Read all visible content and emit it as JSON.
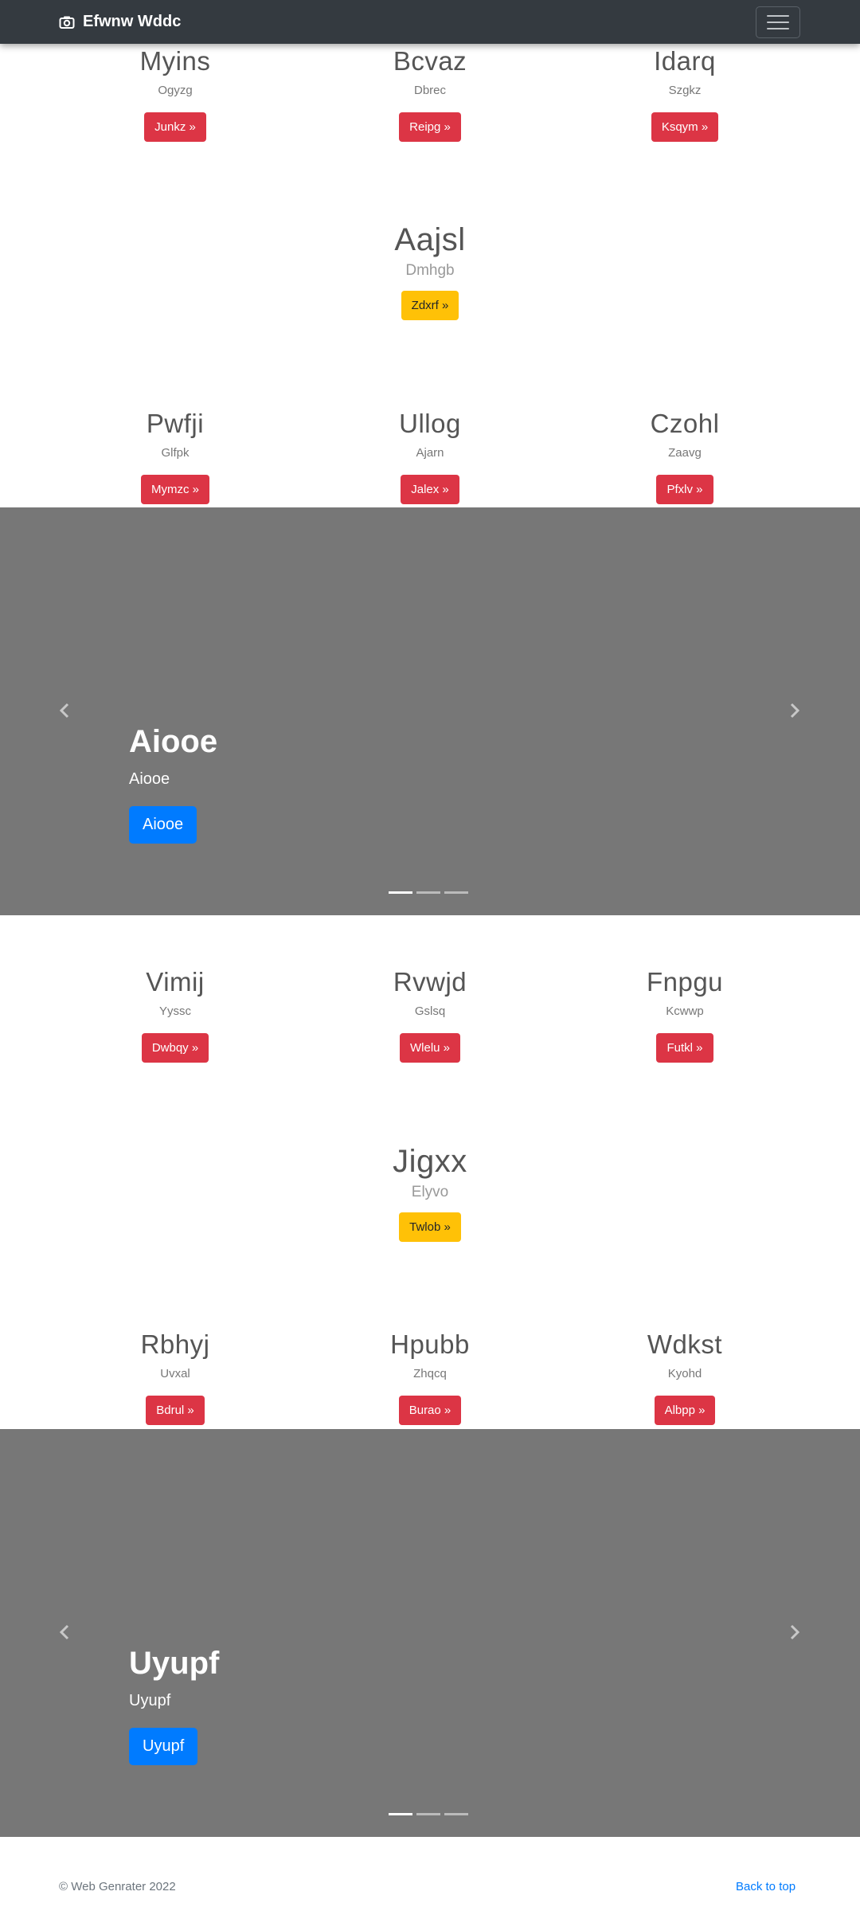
{
  "navbar": {
    "brand": "Efwnw Wddc"
  },
  "block1": {
    "row_top": [
      {
        "title": "Myins",
        "sub": "Ogyzg",
        "btn": "Junkz »"
      },
      {
        "title": "Bcvaz",
        "sub": "Dbrec",
        "btn": "Reipg »"
      },
      {
        "title": "Idarq",
        "sub": "Szgkz",
        "btn": "Ksqym »"
      }
    ],
    "center": {
      "title": "Aajsl",
      "sub": "Dmhgb",
      "btn": "Zdxrf »"
    },
    "row_bottom": [
      {
        "title": "Pwfji",
        "sub": "Glfpk",
        "btn": "Mymzc »"
      },
      {
        "title": "Ullog",
        "sub": "Ajarn",
        "btn": "Jalex »"
      },
      {
        "title": "Czohl",
        "sub": "Zaavg",
        "btn": "Pfxlv »"
      }
    ]
  },
  "carousel1": {
    "title": "Aiooe",
    "sub": "Aiooe",
    "btn": "Aiooe"
  },
  "block2": {
    "row_top": [
      {
        "title": "Vimij",
        "sub": "Yyssc",
        "btn": "Dwbqy »"
      },
      {
        "title": "Rvwjd",
        "sub": "Gslsq",
        "btn": "Wlelu »"
      },
      {
        "title": "Fnpgu",
        "sub": "Kcwwp",
        "btn": "Futkl »"
      }
    ],
    "center": {
      "title": "Jigxx",
      "sub": "Elyvo",
      "btn": "Twlob »"
    },
    "row_bottom": [
      {
        "title": "Rbhyj",
        "sub": "Uvxal",
        "btn": "Bdrul »"
      },
      {
        "title": "Hpubb",
        "sub": "Zhqcq",
        "btn": "Burao »"
      },
      {
        "title": "Wdkst",
        "sub": "Kyohd",
        "btn": "Albpp »"
      }
    ]
  },
  "carousel2": {
    "title": "Uyupf",
    "sub": "Uyupf",
    "btn": "Uyupf"
  },
  "footer": {
    "copyright": "© Web Genrater 2022",
    "back_to_top": "Back to top"
  },
  "colors": {
    "navbar": "#343a40",
    "danger": "#dc3545",
    "warning": "#ffc107",
    "primary": "#007bff",
    "carousel_bg": "#777777"
  },
  "icons": {
    "brand": "camera-icon",
    "prev": "chevron-left-icon",
    "next": "chevron-right-icon",
    "menu": "hamburger-icon"
  }
}
